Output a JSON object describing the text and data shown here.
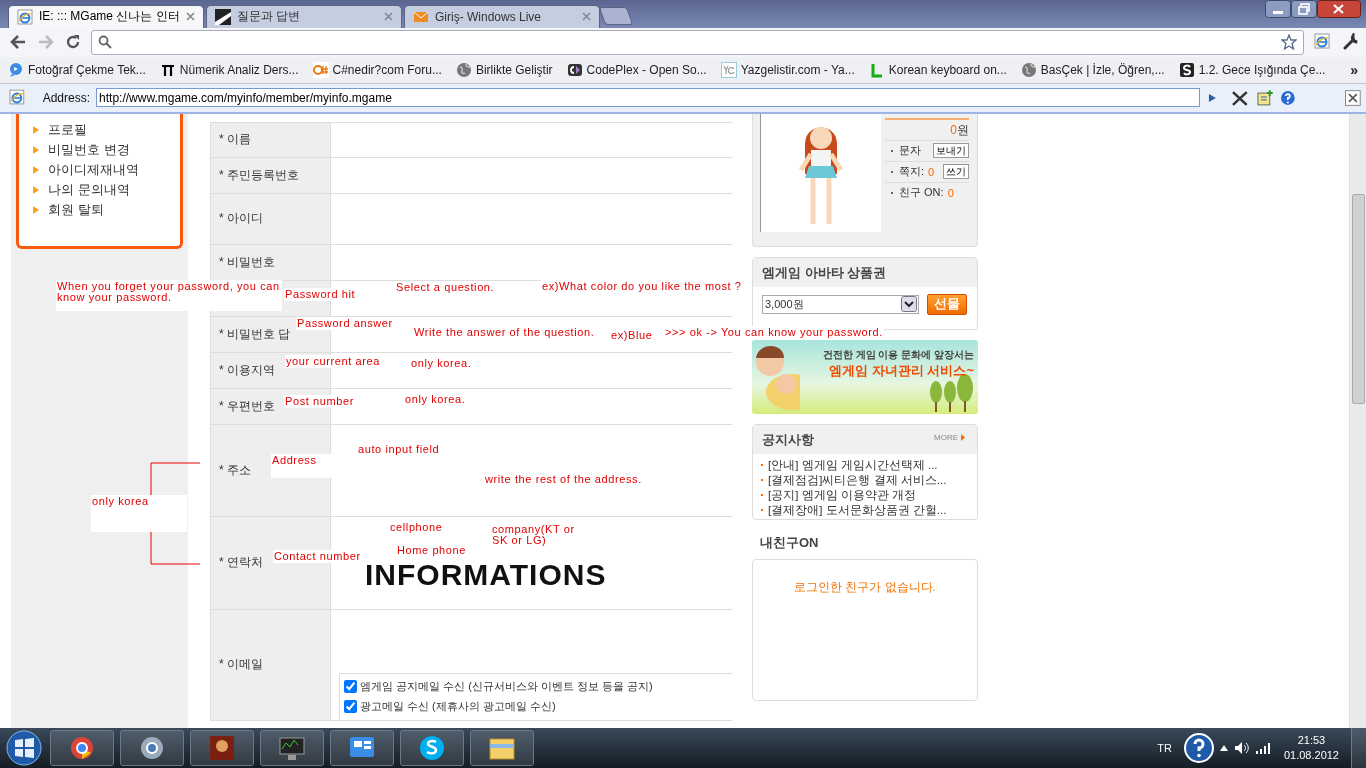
{
  "browser": {
    "tabs": [
      {
        "title": "IE: ::: MGame 신나는 인터",
        "selected": true,
        "kind": "ie"
      },
      {
        "title": "질문과 답변",
        "selected": false,
        "kind": "stripe"
      },
      {
        "title": "Giriş- Windows Live",
        "selected": false,
        "kind": "mail"
      }
    ],
    "bookmarks": [
      {
        "title": "Fotoğraf Çekme Tek...",
        "kind": "bubble"
      },
      {
        "title": "Nümerik Analiz Ders...",
        "kind": "pi"
      },
      {
        "title": "C#nedir?com Foru...",
        "kind": "csharp"
      },
      {
        "title": "Birlikte Geliştir",
        "kind": "globe"
      },
      {
        "title": "CodePlex - Open So...",
        "kind": "codeplex"
      },
      {
        "title": "Yazgelistir.com - Ya...",
        "kind": "yg"
      },
      {
        "title": "Korean keyboard on...",
        "kind": "l"
      },
      {
        "title": "BasÇek | İzle, Öğren,...",
        "kind": "globe"
      },
      {
        "title": "1.2. Gece Işığında Çe...",
        "kind": "s"
      }
    ],
    "bookmarks_more": "»",
    "ie_bar": {
      "label": "Address:",
      "url": "http://www.mgame.com/myinfo/member/myinfo.mgame"
    }
  },
  "sidebar": {
    "items": [
      "프로필",
      "비밀번호 변경",
      "아이디제재내역",
      "나의 문의내역",
      "회원 탈퇴"
    ]
  },
  "form": {
    "rows": [
      {
        "label": "* 이름"
      },
      {
        "label": "* 주민등록번호"
      },
      {
        "label": "* 아이디"
      },
      {
        "label": "* 비밀번호"
      },
      {},
      {
        "label": "* 비밀번호 답"
      },
      {
        "label": "* 이용지역"
      },
      {
        "label": "* 우편번호"
      },
      {
        "label": "* 주소"
      },
      {
        "label": "* 연락처"
      },
      {
        "label": "* 이메일",
        "options": [
          {
            "label": "엠게임 공지메일 수신 (신규서비스와 이벤트 정보 등을 공지)",
            "checked": true
          },
          {
            "label": "광고메일 수신 (제휴사의 광고메일 수신)",
            "checked": true
          }
        ]
      }
    ],
    "banner_text": "INFORMATIONS"
  },
  "profile": {
    "balance_value": "0",
    "balance_unit": "원",
    "rows": [
      {
        "label": "문자",
        "button": "보내기"
      },
      {
        "label": "쪽지:",
        "count": "0",
        "button": "쓰기"
      },
      {
        "label": "친구 ON:",
        "count": "0"
      }
    ]
  },
  "voucher": {
    "title": "엠게임 아바타 상품권",
    "select": "3,000원",
    "button": "선물"
  },
  "promo": {
    "line1": "건전한 게임 이용 문화에 앞장서는",
    "line2": "엠게임 자녀관리 서비스~"
  },
  "notices": {
    "title": "공지사항",
    "more": "MORE",
    "items": [
      "[안내] 엠게임 게임시간선택제 ...",
      "[결제점검]씨티은행 결제 서비스...",
      "[공지] 엠게임 이용약관 개정",
      "[결제장애] 도서문화상품권 간헐..."
    ]
  },
  "friends": {
    "title": "내친구ON",
    "empty": "로그인한 친구가 없습니다."
  },
  "annotations": [
    {
      "text": "When you forget your password, you can know your password."
    },
    {
      "text": "Password hit"
    },
    {
      "text": "Select a question."
    },
    {
      "text": "ex)What color do you like the most ?"
    },
    {
      "text": "Password answer"
    },
    {
      "text": "Write the answer of the question."
    },
    {
      "text": "ex)Blue"
    },
    {
      "text": ">>> ok -> You can know your password."
    },
    {
      "text": "your current area"
    },
    {
      "text": "only korea."
    },
    {
      "text": "Post number"
    },
    {
      "text": "only korea."
    },
    {
      "text": "auto input field"
    },
    {
      "text": "Address"
    },
    {
      "text": "write the rest of the address."
    },
    {
      "text": "only korea"
    },
    {
      "text": "cellphone"
    },
    {
      "text": "company(KT or SK or LG)"
    },
    {
      "text": "Contact number"
    },
    {
      "text": "Home phone"
    }
  ],
  "taskbar": {
    "language": "TR",
    "time": "21:53",
    "date": "01.08.2012"
  }
}
